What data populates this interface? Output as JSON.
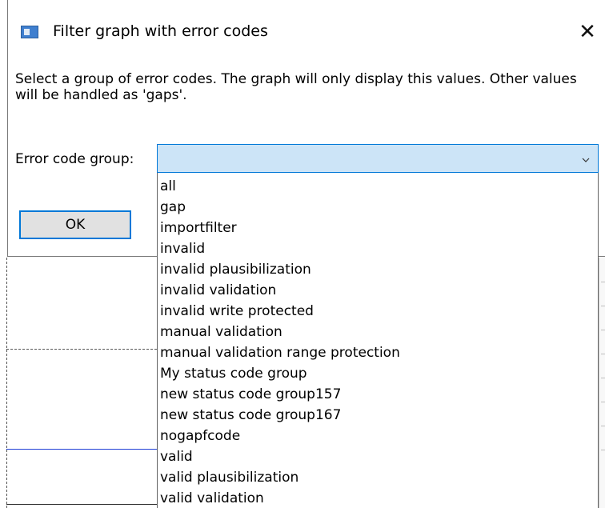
{
  "dialog": {
    "title": "Filter graph with error codes",
    "close_glyph": "✕",
    "instructions": "Select a group of error codes. The graph will only display this values. Other values will be handled as 'gaps'.",
    "field_label": "Error code group:",
    "ok_label": "OK"
  },
  "combo": {
    "selected_value": "",
    "items": [
      "all",
      "gap",
      "importfilter",
      "invalid",
      "invalid plausibilization",
      "invalid validation",
      "invalid write protected",
      "manual validation",
      "manual validation range protection",
      "My status code group",
      "new status code group157",
      "new status code group167",
      "nogapfcode",
      "valid",
      "valid plausibilization",
      "valid validation"
    ]
  },
  "colors": {
    "accent": "#0078d7",
    "combo_bg": "#cce4f7",
    "graph_line": "#1f3fd6"
  },
  "icons": {
    "app": "app-window-icon",
    "close": "close-icon",
    "dropdown": "chevron-down-icon"
  }
}
